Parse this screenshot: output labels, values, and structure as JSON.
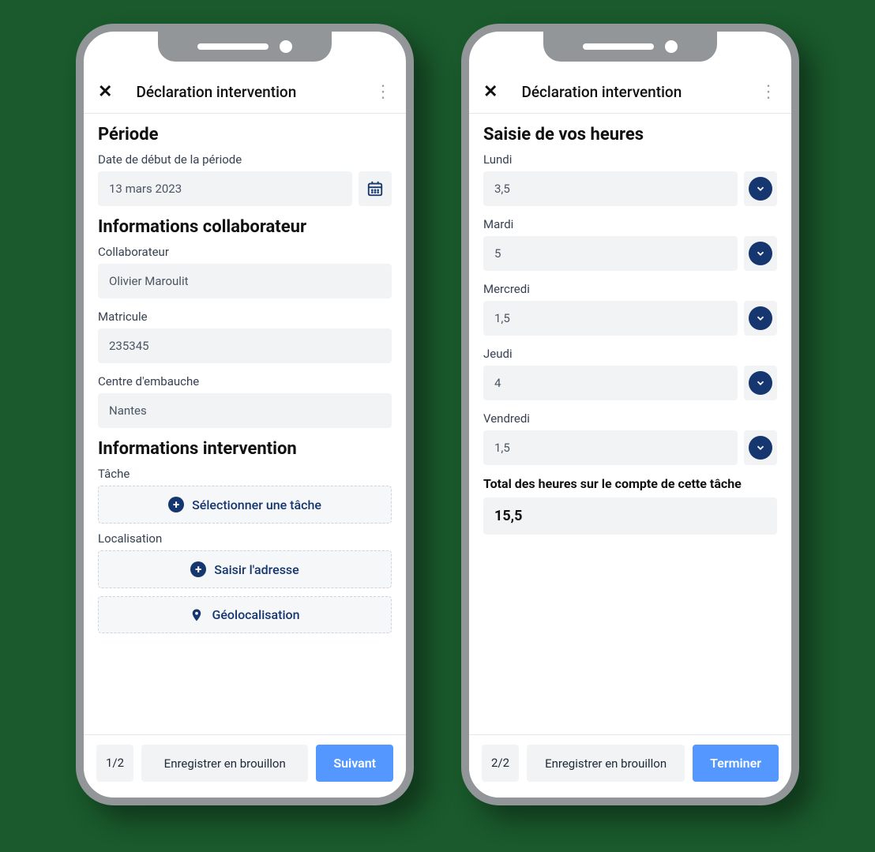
{
  "phone1": {
    "header": {
      "title": "Déclaration intervention"
    },
    "sections": {
      "period": {
        "title": "Période",
        "start_label": "Date de début de la période",
        "start_value": "13 mars 2023"
      },
      "collaborator": {
        "title": "Informations collaborateur",
        "name_label": "Collaborateur",
        "name_value": "Olivier Maroulit",
        "matricule_label": "Matricule",
        "matricule_value": "235345",
        "center_label": "Centre d'embauche",
        "center_value": "Nantes"
      },
      "intervention": {
        "title": "Informations intervention",
        "task_label": "Tâche",
        "task_button": "Sélectionner une tâche",
        "location_label": "Localisation",
        "address_button": "Saisir l'adresse",
        "geo_button": "Géolocalisation"
      }
    },
    "footer": {
      "page": "1/2",
      "draft": "Enregistrer en brouillon",
      "next": "Suivant"
    }
  },
  "phone2": {
    "header": {
      "title": "Déclaration intervention"
    },
    "section_title": "Saisie de vos heures",
    "days": {
      "mon": {
        "label": "Lundi",
        "value": "3,5"
      },
      "tue": {
        "label": "Mardi",
        "value": "5"
      },
      "wed": {
        "label": "Mercredi",
        "value": "1,5"
      },
      "thu": {
        "label": "Jeudi",
        "value": "4"
      },
      "fri": {
        "label": "Vendredi",
        "value": "1,5"
      }
    },
    "total": {
      "label": "Total des heures sur le compte de cette tâche",
      "value": "15,5"
    },
    "footer": {
      "page": "2/2",
      "draft": "Enregistrer en brouillon",
      "finish": "Terminer"
    }
  }
}
